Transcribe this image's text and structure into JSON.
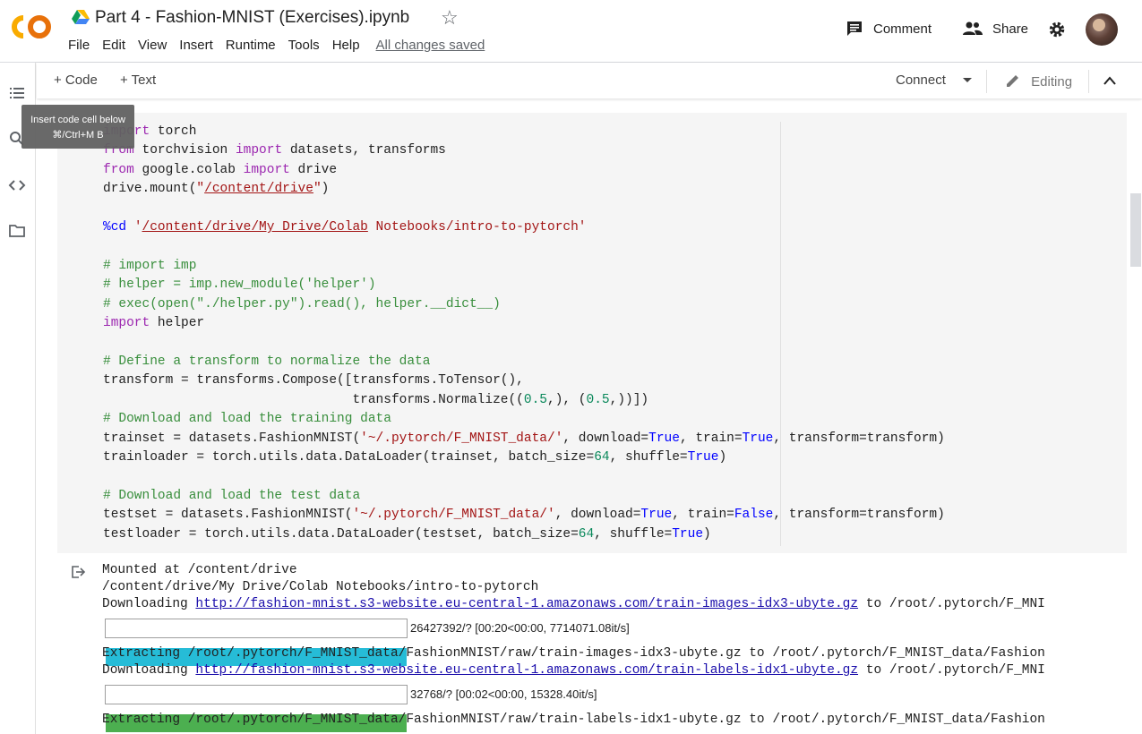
{
  "header": {
    "title": "Part 4 - Fashion-MNIST (Exercises).ipynb",
    "menu": [
      "File",
      "Edit",
      "View",
      "Insert",
      "Runtime",
      "Tools",
      "Help"
    ],
    "save_status": "All changes saved",
    "comment_label": "Comment",
    "share_label": "Share"
  },
  "toolbar": {
    "code_label": "+ Code",
    "text_label": "+ Text",
    "connect_label": "Connect",
    "editing_label": "Editing"
  },
  "tooltip": {
    "line1": "Insert code cell below",
    "line2": "⌘/Ctrl+M B"
  },
  "output": {
    "line1": "Mounted at /content/drive",
    "line2": "/content/drive/My Drive/Colab Notebooks/intro-to-pytorch",
    "dl1_prefix": "Downloading ",
    "dl1_url": "http://fashion-mnist.s3-website.eu-central-1.amazonaws.com/train-images-idx3-ubyte.gz",
    "dl1_suffix": " to /root/.pytorch/F_MNI",
    "progress1": {
      "text": "26427392/? [00:20<00:00, 7714071.08it/s]",
      "fraction": 1.0,
      "color": "#26bcd7"
    },
    "extract1": "Extracting /root/.pytorch/F_MNIST_data/FashionMNIST/raw/train-images-idx3-ubyte.gz to /root/.pytorch/F_MNIST_data/Fashion",
    "dl2_prefix": "Downloading ",
    "dl2_url": "http://fashion-mnist.s3-website.eu-central-1.amazonaws.com/train-labels-idx1-ubyte.gz",
    "dl2_suffix": " to /root/.pytorch/F_MNI",
    "progress2": {
      "text": "32768/? [00:02<00:00, 15328.40it/s]",
      "fraction": 1.0,
      "color": "#4caf50"
    },
    "extract2": "Extracting /root/.pytorch/F_MNIST_data/FashionMNIST/raw/train-labels-idx1-ubyte.gz to /root/.pytorch/F_MNIST_data/Fashion"
  },
  "code_lines": [
    "import torch",
    "from torchvision import datasets, transforms",
    "from google.colab import drive",
    "drive.mount(\"/content/drive\")",
    "",
    "%cd '/content/drive/My Drive/Colab Notebooks/intro-to-pytorch'",
    "",
    "# import imp",
    "# helper = imp.new_module('helper')",
    "# exec(open(\"./helper.py\").read(), helper.__dict__)",
    "import helper",
    "",
    "# Define a transform to normalize the data",
    "transform = transforms.Compose([transforms.ToTensor(),",
    "                                transforms.Normalize((0.5,), (0.5,))])",
    "# Download and load the training data",
    "trainset = datasets.FashionMNIST('~/.pytorch/F_MNIST_data/', download=True, train=True, transform=transform)",
    "trainloader = torch.utils.data.DataLoader(trainset, batch_size=64, shuffle=True)",
    "",
    "# Download and load the test data",
    "testset = datasets.FashionMNIST('~/.pytorch/F_MNIST_data/', download=True, train=False, transform=transform)",
    "testloader = torch.utils.data.DataLoader(testset, batch_size=64, shuffle=True)"
  ],
  "colors": {
    "keyword": "#9c27b0",
    "string": "#a31515",
    "comment": "#388e3c",
    "number": "#09885a",
    "boolean": "#0000ff",
    "logo_orange": "#f9ab00"
  },
  "icons": {
    "rail": [
      "toc-icon",
      "search-icon",
      "code-snippets-icon",
      "folder-icon"
    ],
    "header": [
      "comment-icon",
      "share-icon",
      "gear-icon"
    ]
  }
}
